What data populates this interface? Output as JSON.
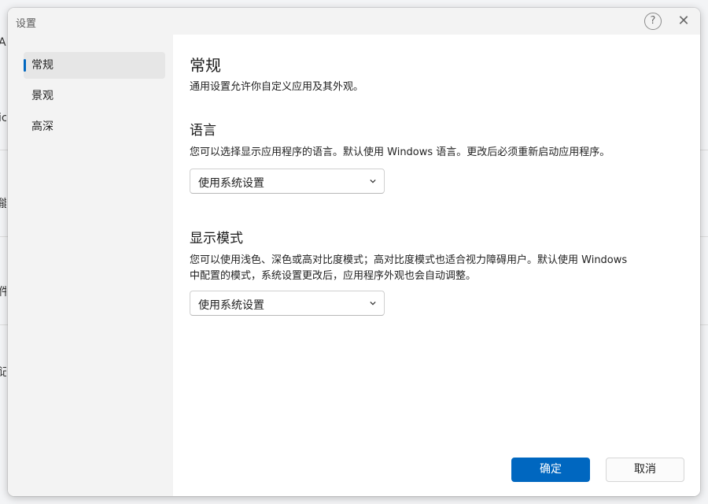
{
  "background": {
    "fragments": [
      "A",
      "ic",
      "能",
      "件",
      "记"
    ]
  },
  "dialog": {
    "title": "设置",
    "help_icon_glyph": "?",
    "close_icon_glyph": "✕"
  },
  "sidebar": {
    "items": [
      {
        "label": "常规",
        "active": true
      },
      {
        "label": "景观",
        "active": false
      },
      {
        "label": "高深",
        "active": false
      }
    ]
  },
  "main": {
    "title": "常规",
    "subtitle": "通用设置允许你自定义应用及其外观。",
    "language": {
      "heading": "语言",
      "description": "您可以选择显示应用程序的语言。默认使用 Windows 语言。更改后必须重新启动应用程序。",
      "selected": "使用系统设置"
    },
    "display_mode": {
      "heading": "显示模式",
      "description_line1": "您可以使用浅色、深色或高对比度模式；高对比度模式也适合视力障碍用户。默认使用 Windows",
      "description_line2": "中配置的模式，系统设置更改后，应用程序外观也会自动调整。",
      "selected": "使用系统设置"
    }
  },
  "footer": {
    "ok_label": "确定",
    "cancel_label": "取消"
  },
  "colors": {
    "accent": "#0067c0",
    "sidebar_bg": "#f3f3f3"
  }
}
